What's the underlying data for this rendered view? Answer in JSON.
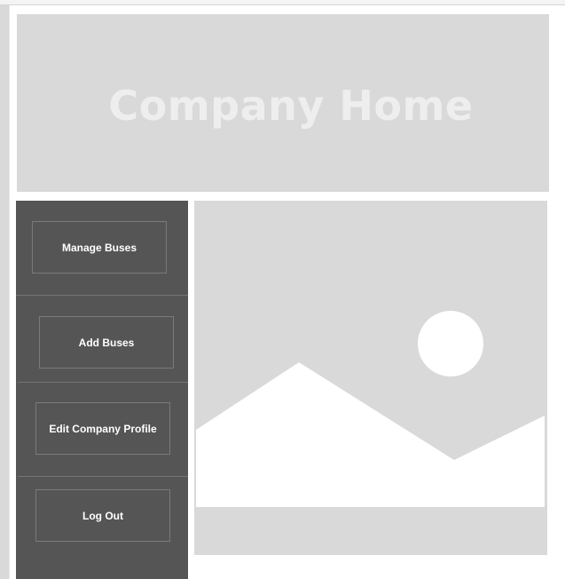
{
  "header": {
    "title": "Company Home"
  },
  "nav": {
    "items": [
      {
        "label": "Manage Buses"
      },
      {
        "label": "Add Buses"
      },
      {
        "label": "Edit Company Profile"
      },
      {
        "label": "Log Out"
      }
    ]
  },
  "main": {
    "image_icon": "image-placeholder-icon"
  },
  "colors": {
    "header_bg": "#d9d9d9",
    "header_text": "#eeeeee",
    "nav_bg": "#555555",
    "nav_text": "#ffffff",
    "button_border": "#7a7a7a",
    "placeholder_bg": "#d9d9d9",
    "placeholder_shape": "#ffffff"
  }
}
